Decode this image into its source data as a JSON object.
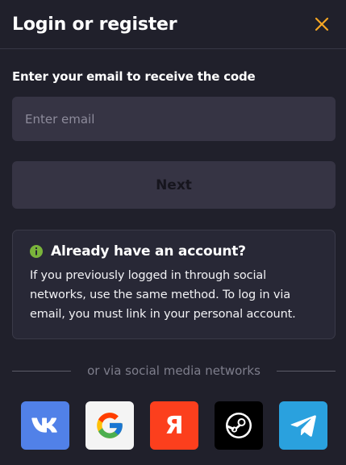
{
  "header": {
    "title": "Login or register",
    "close_icon": "close-icon",
    "accent_color": "#f5a623"
  },
  "form": {
    "label": "Enter your email to receive the code",
    "email_placeholder": "Enter email",
    "email_value": "",
    "next_label": "Next"
  },
  "info": {
    "icon": "info-icon",
    "title": "Already have an account?",
    "text": "If you previously logged in through social networks, use the same method. To log in via email, you must link in your personal account."
  },
  "social": {
    "divider_text": "or via social media networks",
    "items": [
      {
        "name": "vk",
        "icon": "vk-icon",
        "color": "#5181e8"
      },
      {
        "name": "google",
        "icon": "google-icon",
        "color": "#f4f4f4"
      },
      {
        "name": "yandex",
        "icon": "yandex-icon",
        "color": "#fc3f1d"
      },
      {
        "name": "steam",
        "icon": "steam-icon",
        "color": "#000000"
      },
      {
        "name": "telegram",
        "icon": "telegram-icon",
        "color": "#2aa1de"
      }
    ]
  }
}
